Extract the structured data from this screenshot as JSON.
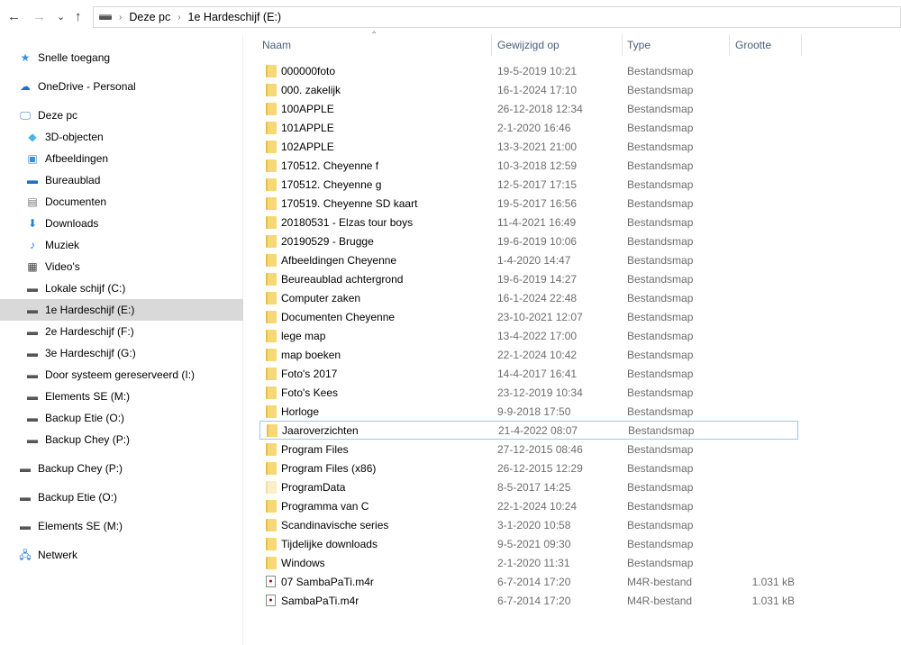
{
  "nav": {
    "back": "←",
    "forward": "→",
    "recent": "⌄",
    "up": "↑"
  },
  "breadcrumb": [
    "Deze pc",
    "1e Hardeschijf (E:)"
  ],
  "sidebar": {
    "top": [
      {
        "label": "Snelle toegang",
        "icon": "star-icon"
      },
      {
        "label": "OneDrive - Personal",
        "icon": "cloud-icon"
      },
      {
        "label": "Deze pc",
        "icon": "computer-icon"
      }
    ],
    "pc_items": [
      {
        "label": "3D-objecten",
        "icon": "cube-icon"
      },
      {
        "label": "Afbeeldingen",
        "icon": "pictures-icon"
      },
      {
        "label": "Bureaublad",
        "icon": "desktop-icon"
      },
      {
        "label": "Documenten",
        "icon": "document-icon"
      },
      {
        "label": "Downloads",
        "icon": "download-icon"
      },
      {
        "label": "Muziek",
        "icon": "music-icon"
      },
      {
        "label": "Video's",
        "icon": "video-icon"
      },
      {
        "label": "Lokale schijf (C:)",
        "icon": "drive-icon"
      },
      {
        "label": "1e Hardeschijf (E:)",
        "icon": "drive-icon"
      },
      {
        "label": "2e Hardeschijf (F:)",
        "icon": "drive-icon"
      },
      {
        "label": "3e Hardeschijf (G:)",
        "icon": "drive-icon"
      },
      {
        "label": "Door systeem gereserveerd (I:)",
        "icon": "drive-icon"
      },
      {
        "label": "Elements SE (M:)",
        "icon": "drive-icon"
      },
      {
        "label": "Backup Etie (O:)",
        "icon": "drive-icon"
      },
      {
        "label": "Backup Chey (P:)",
        "icon": "drive-icon"
      }
    ],
    "bottom": [
      {
        "label": "Backup Chey (P:)",
        "icon": "drive-icon"
      },
      {
        "label": "Backup Etie (O:)",
        "icon": "drive-icon"
      },
      {
        "label": "Elements SE (M:)",
        "icon": "drive-icon"
      },
      {
        "label": "Netwerk",
        "icon": "network-icon"
      }
    ],
    "selected": "1e Hardeschijf (E:)"
  },
  "columns": {
    "name": "Naam",
    "date": "Gewijzigd op",
    "type": "Type",
    "size": "Grootte"
  },
  "files": [
    [
      "000000foto",
      "19-5-2019 10:21",
      "Bestandsmap",
      ""
    ],
    [
      "000. zakelijk",
      "16-1-2024 17:10",
      "Bestandsmap",
      ""
    ],
    [
      "100APPLE",
      "26-12-2018 12:34",
      "Bestandsmap",
      ""
    ],
    [
      "101APPLE",
      "2-1-2020 16:46",
      "Bestandsmap",
      ""
    ],
    [
      "102APPLE",
      "13-3-2021 21:00",
      "Bestandsmap",
      ""
    ],
    [
      "170512. Cheyenne f",
      "10-3-2018 12:59",
      "Bestandsmap",
      ""
    ],
    [
      "170512. Cheyenne g",
      "12-5-2017 17:15",
      "Bestandsmap",
      ""
    ],
    [
      "170519. Cheyenne SD kaart",
      "19-5-2017 16:56",
      "Bestandsmap",
      ""
    ],
    [
      "20180531 - Elzas tour boys",
      "11-4-2021 16:49",
      "Bestandsmap",
      ""
    ],
    [
      "20190529  - Brugge",
      "19-6-2019 10:06",
      "Bestandsmap",
      ""
    ],
    [
      "Afbeeldingen Cheyenne",
      "1-4-2020 14:47",
      "Bestandsmap",
      ""
    ],
    [
      "Beureaublad achtergrond",
      "19-6-2019 14:27",
      "Bestandsmap",
      ""
    ],
    [
      "Computer zaken",
      "16-1-2024 22:48",
      "Bestandsmap",
      ""
    ],
    [
      "Documenten Cheyenne",
      "23-10-2021 12:07",
      "Bestandsmap",
      ""
    ],
    [
      "lege map",
      "13-4-2022 17:00",
      "Bestandsmap",
      ""
    ],
    [
      "map boeken",
      "22-1-2024 10:42",
      "Bestandsmap",
      ""
    ],
    [
      "Foto's 2017",
      "14-4-2017 16:41",
      "Bestandsmap",
      ""
    ],
    [
      "Foto's Kees",
      "23-12-2019 10:34",
      "Bestandsmap",
      ""
    ],
    [
      "Horloge",
      "9-9-2018 17:50",
      "Bestandsmap",
      ""
    ],
    [
      "Jaaroverzichten",
      "21-4-2022 08:07",
      "Bestandsmap",
      ""
    ],
    [
      "Program Files",
      "27-12-2015 08:46",
      "Bestandsmap",
      ""
    ],
    [
      "Program Files (x86)",
      "26-12-2015 12:29",
      "Bestandsmap",
      ""
    ],
    [
      "ProgramData",
      "8-5-2017 14:25",
      "Bestandsmap",
      ""
    ],
    [
      "Programma van C",
      "22-1-2024 10:24",
      "Bestandsmap",
      ""
    ],
    [
      "Scandinavische series",
      "3-1-2020 10:58",
      "Bestandsmap",
      ""
    ],
    [
      "Tijdelijke downloads",
      "9-5-2021 09:30",
      "Bestandsmap",
      ""
    ],
    [
      "Windows",
      "2-1-2020 11:31",
      "Bestandsmap",
      ""
    ],
    [
      "07 SambaPaTi.m4r",
      "6-7-2014 17:20",
      "M4R-bestand",
      "1.031 kB"
    ],
    [
      "SambaPaTi.m4r",
      "6-7-2014 17:20",
      "M4R-bestand",
      "1.031 kB"
    ]
  ],
  "focused_row": "Jaaroverzichten"
}
